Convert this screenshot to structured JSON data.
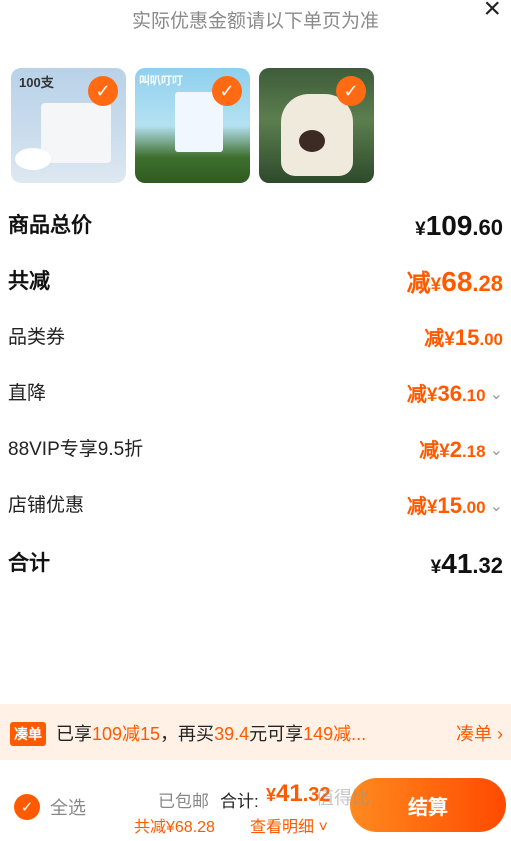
{
  "header": {
    "notice": "实际优惠金额请以下单页为准",
    "close_label": "×"
  },
  "products": [
    {
      "name": "product-1",
      "overlay_text": "100支"
    },
    {
      "name": "product-2",
      "overlay_text": "叫叭叮叮"
    },
    {
      "name": "product-3",
      "overlay_text": ""
    }
  ],
  "summary": {
    "goods_total_label": "商品总价",
    "goods_total_yen": "¥",
    "goods_total_int": "109",
    "goods_total_dec": ".60",
    "total_discount_label": "共减",
    "total_discount_prefix": "减",
    "total_discount_yen": "¥",
    "total_discount_int": "68",
    "total_discount_dec": ".28",
    "items": [
      {
        "label": "品类券",
        "prefix": "减",
        "yen": "¥",
        "int": "15",
        "dec": ".00",
        "has_chevron": false
      },
      {
        "label": "直降",
        "prefix": "减",
        "yen": "¥",
        "int": "36",
        "dec": ".10",
        "has_chevron": true
      },
      {
        "label": "88VIP专享9.5折",
        "prefix": "减",
        "yen": "¥",
        "int": "2",
        "dec": ".18",
        "has_chevron": true
      },
      {
        "label": "店铺优惠",
        "prefix": "减",
        "yen": "¥",
        "int": "15",
        "dec": ".00",
        "has_chevron": true
      }
    ],
    "sum_label": "合计",
    "sum_yen": "¥",
    "sum_int": "41",
    "sum_dec": ".32"
  },
  "promo": {
    "badge": "凑单",
    "text_a": "已享",
    "text_b": "109减15",
    "text_c": "，再买",
    "text_d": "39.4",
    "text_e": "元可享",
    "text_f": "149减...",
    "link": "凑单 ›"
  },
  "bottom": {
    "select_all": "全选",
    "shipping": "已包邮",
    "total_label": "合计:",
    "total_yen": "¥",
    "total_int": "41",
    "total_dec": ".32",
    "saved": "共减¥68.28",
    "details": "查看明细 ˅",
    "checkout": "结算",
    "watermark": "值得比"
  },
  "colors": {
    "accent": "#ff5a00",
    "promo_bg": "#fff1e6"
  }
}
